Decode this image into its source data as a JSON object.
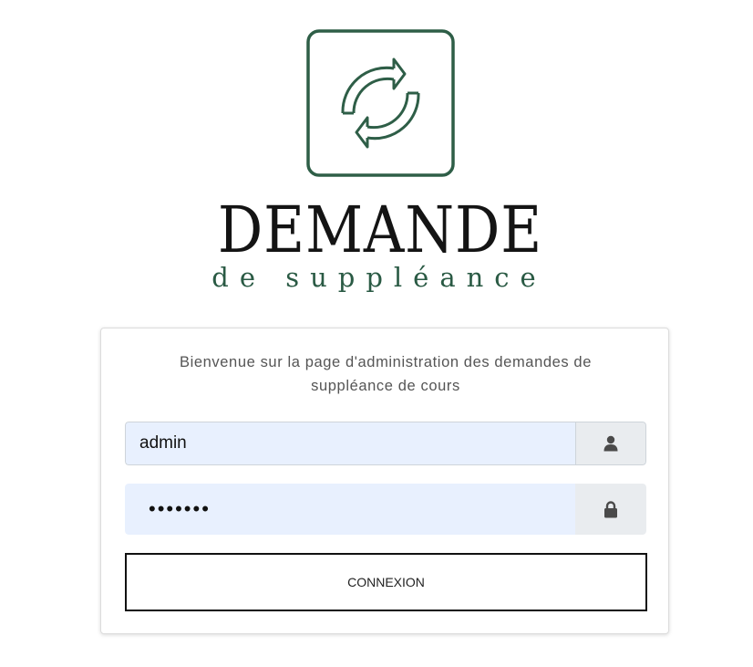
{
  "logo": {
    "word": "DEMANDE",
    "subtitle": "de suppléance",
    "icon": "refresh-arrows-icon",
    "brand_color": "#2e5e47"
  },
  "login": {
    "welcome_text": "Bienvenue sur la page d'administration des demandes de suppléance de cours",
    "username_value": "admin",
    "username_icon": "user-icon",
    "password_value": "•••••••",
    "password_icon": "lock-icon",
    "submit_label": "CONNEXION"
  },
  "colors": {
    "input_autofill_bg": "#e8f0fe",
    "addon_bg": "#e9ecef",
    "icon_color": "#4a4a4a"
  }
}
